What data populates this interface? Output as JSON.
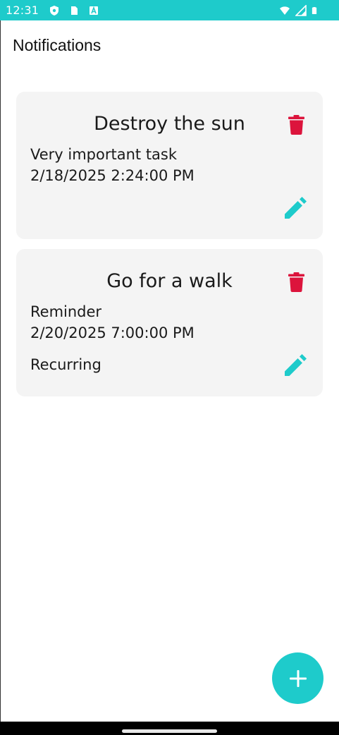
{
  "status_bar": {
    "time": "12:31",
    "left_icons": [
      "shield-icon",
      "sd-card-icon",
      "font-icon"
    ],
    "right_icons": [
      "wifi-icon",
      "signal-icon",
      "battery-icon"
    ],
    "color": "#1ecbcb"
  },
  "header": {
    "title": "Notifications"
  },
  "notifications": [
    {
      "title": "Destroy the sun",
      "description": "Very important task",
      "datetime": "2/18/2025 2:24:00 PM",
      "recurring": ""
    },
    {
      "title": "Go for a walk",
      "description": "Reminder",
      "datetime": "2/20/2025 7:00:00 PM",
      "recurring": "Recurring"
    }
  ],
  "icons": {
    "delete": "trash-icon",
    "edit": "pencil-icon",
    "add": "plus-icon"
  },
  "colors": {
    "accent": "#1ecbcb",
    "delete": "#dc143c",
    "card_bg": "#f4f4f4"
  }
}
